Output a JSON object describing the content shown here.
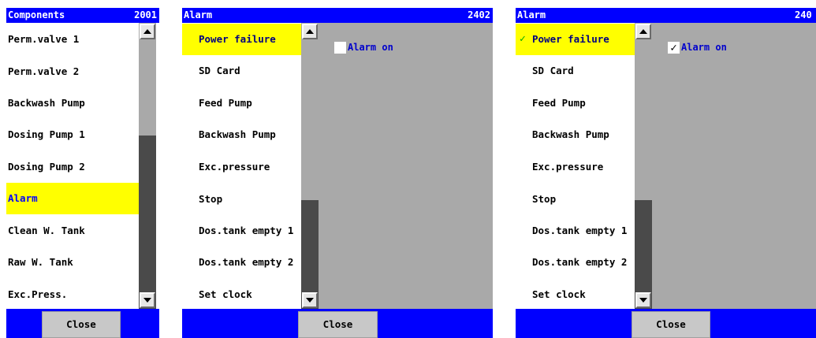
{
  "panels": [
    {
      "title": "Components",
      "code": "2001",
      "items": [
        "Perm.valve 1",
        "Perm.valve 2",
        "Backwash Pump",
        "Dosing Pump 1",
        "Dosing Pump 2",
        "Alarm",
        "Clean W. Tank",
        "Raw W. Tank",
        "Exc.Press."
      ],
      "selected_index": 5,
      "close_label": "Close"
    },
    {
      "title": "Alarm",
      "code": "2402",
      "items": [
        "Power failure",
        "SD Card",
        "Feed Pump",
        "Backwash Pump",
        "Exc.pressure",
        "Stop",
        "Dos.tank empty 1",
        "Dos.tank empty 2",
        "Set clock"
      ],
      "selected_index": 0,
      "checkbox": {
        "label": "Alarm on",
        "checked": false
      },
      "close_label": "Close"
    },
    {
      "title": "Alarm",
      "code": "240",
      "items": [
        "Power failure",
        "SD Card",
        "Feed Pump",
        "Backwash Pump",
        "Exc.pressure",
        "Stop",
        "Dos.tank empty 1",
        "Dos.tank empty 2",
        "Set clock"
      ],
      "selected_index": 0,
      "selected_checkmark": "✓",
      "checkbox": {
        "label": "Alarm on",
        "checked": true,
        "check_glyph": "✓"
      },
      "close_label": "Close"
    }
  ],
  "colors": {
    "titlebar": "#0000ff",
    "selected": "#ffff00",
    "scrollbar": "#a9a9a9",
    "checkmark": "#00aa00"
  }
}
